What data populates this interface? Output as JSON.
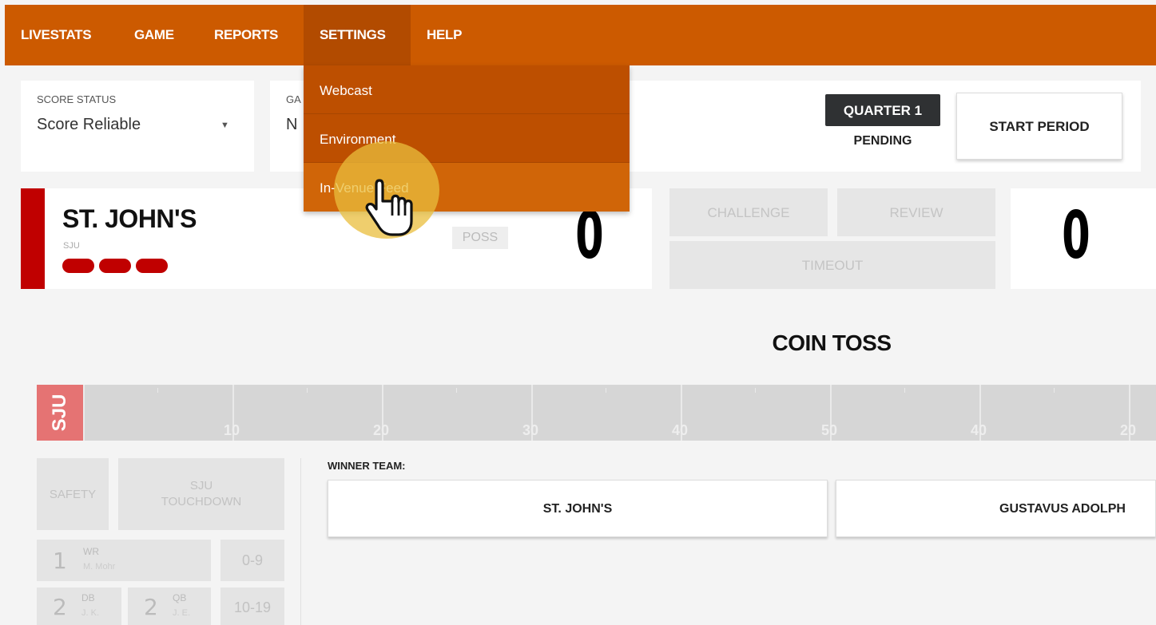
{
  "nav": {
    "items": [
      "LIVESTATS",
      "GAME",
      "REPORTS",
      "SETTINGS",
      "HELP"
    ],
    "active": "SETTINGS",
    "settings_menu": [
      "Webcast",
      "Environment",
      "In-Venue Feed"
    ],
    "hovered_item": "In-Venue Feed"
  },
  "score_status": {
    "label": "SCORE STATUS",
    "value": "Score Reliable"
  },
  "game_status": {
    "label": "GA",
    "value": "N"
  },
  "period": {
    "badge": "QUARTER 1",
    "status": "PENDING",
    "start_button": "START PERIOD"
  },
  "home_team": {
    "name": "ST. JOHN'S",
    "abbr": "SJU",
    "color": "#c00000",
    "timeouts_remaining": 3,
    "poss_label": "POSS",
    "score": "0"
  },
  "away_team": {
    "name": "GUSTAVUS ADOLPH",
    "score": "0"
  },
  "actions": {
    "challenge": "CHALLENGE",
    "review": "REVIEW",
    "timeout": "TIMEOUT"
  },
  "phase_title": "COIN TOSS",
  "field": {
    "endzone_label": "SJU",
    "yard_numbers": [
      "10",
      "20",
      "30",
      "40",
      "50",
      "40",
      "20"
    ]
  },
  "scoring_buttons": {
    "safety": "SAFETY",
    "touchdown_team": "SJU",
    "touchdown": "TOUCHDOWN"
  },
  "depth": {
    "rows": [
      {
        "num": "1",
        "pos": "WR",
        "who": "M. Mohr"
      },
      {
        "num": "2",
        "pos": "DB",
        "who": "J. K."
      },
      {
        "num": "2",
        "pos": "QB",
        "who": "J. E."
      }
    ],
    "ranges": [
      "0-9",
      "10-19"
    ]
  },
  "coin_toss": {
    "winner_label": "WINNER TEAM:",
    "home_button": "ST. JOHN'S",
    "away_button": "GUSTAVUS ADOLPH"
  },
  "colors": {
    "nav_bg": "#cc5a00",
    "dropdown_bg": "#bd4f00",
    "team_red": "#c00000",
    "endzone": "#e57373"
  }
}
